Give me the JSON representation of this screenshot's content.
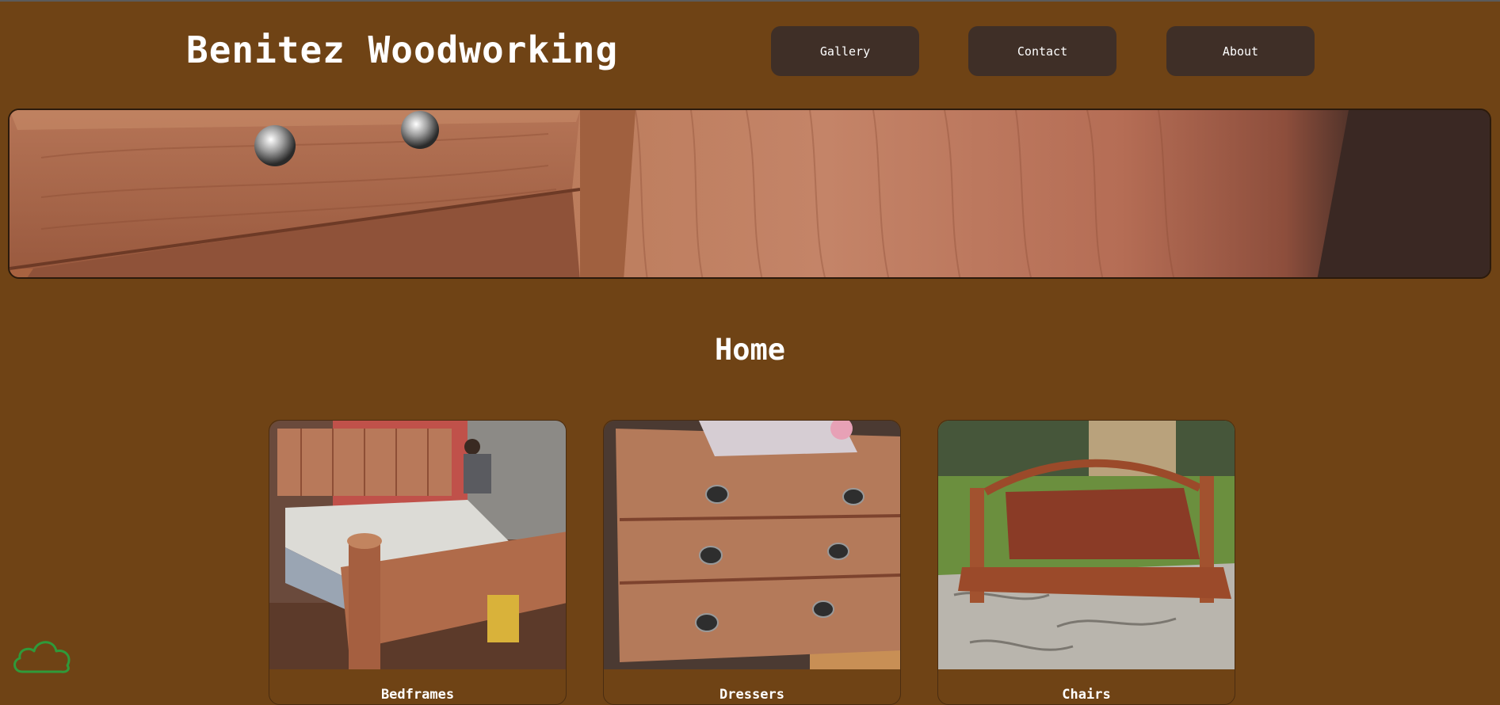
{
  "header": {
    "site_title": "Benitez Woodworking",
    "nav": [
      {
        "label": "Gallery"
      },
      {
        "label": "Contact"
      },
      {
        "label": "About"
      }
    ]
  },
  "main": {
    "heading": "Home",
    "cards": [
      {
        "label": "Bedframes",
        "image": "cedar bedframe photo"
      },
      {
        "label": "Dressers",
        "image": "cedar dresser photo"
      },
      {
        "label": "Chairs",
        "image": "cedar porch swing photo"
      }
    ]
  },
  "banner": {
    "image": "cedar drawer closeup"
  },
  "widget": {
    "icon": "cloud-icon"
  },
  "colors": {
    "background": "#6f4315",
    "nav_button": "#3f2f27",
    "text": "#ffffff",
    "cloud_outline": "#2f9a3a"
  }
}
